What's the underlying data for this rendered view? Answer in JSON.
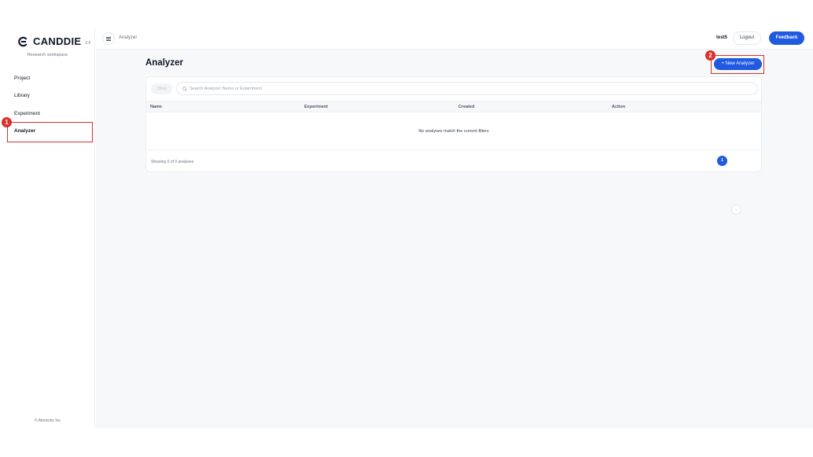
{
  "app": {
    "brand": "CANDDIE",
    "version": "2.0",
    "subtitle": "Research workspace",
    "copyright": "© Atomictic Inc"
  },
  "sidebar": {
    "items": [
      {
        "label": "Project"
      },
      {
        "label": "Library"
      },
      {
        "label": "Experiment"
      },
      {
        "label": "Analyzer",
        "active": true
      }
    ]
  },
  "header": {
    "breadcrumb": "Analyzer",
    "user": "test5",
    "logout_label": "Logout",
    "feedback_label": "Feedback"
  },
  "page": {
    "title": "Analyzer",
    "new_button_label": "+ New Analyzer"
  },
  "filters": {
    "clear_label": "Clear",
    "search_placeholder": "Search Analyzer Name or Experiment",
    "search_value": ""
  },
  "table": {
    "columns": [
      "Name",
      "Experiment",
      "Created",
      "Action"
    ],
    "rows": [],
    "empty_text": "No analyses match the current filters",
    "showing_text": "Showing 0 of 0 analyses"
  },
  "pagination": {
    "prev": "‹",
    "current": "1",
    "next": "›"
  },
  "annotations": [
    {
      "number": "1",
      "target": "Analyzer sidebar item"
    },
    {
      "number": "2",
      "target": "+ New Analyzer button"
    }
  ],
  "colors": {
    "accent": "#1f5ae0",
    "annotation": "#d9302b",
    "background": "#f7f8fa"
  }
}
